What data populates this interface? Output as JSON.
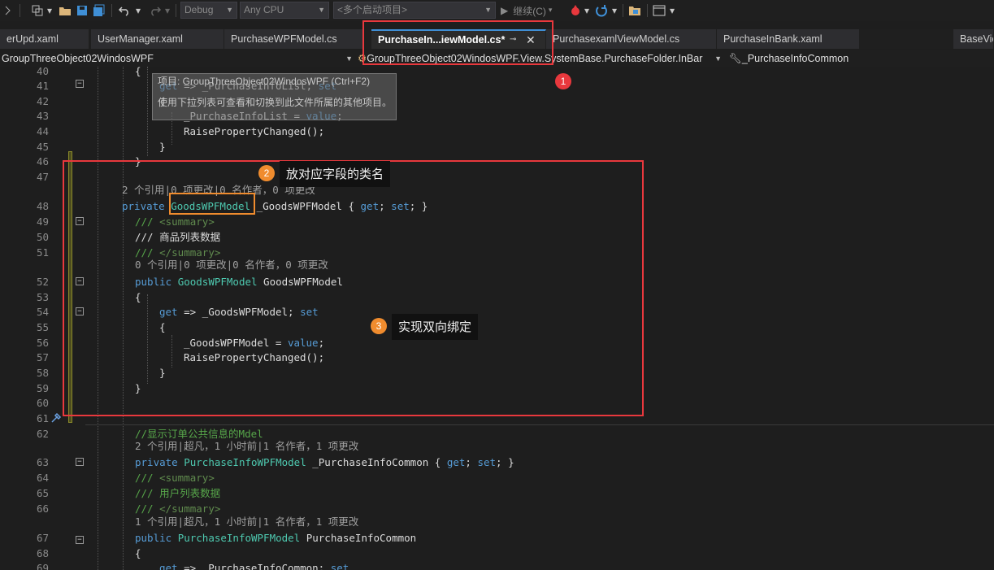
{
  "toolbar": {
    "config": "Debug",
    "platform": "Any CPU",
    "startup": "<多个启动项目>",
    "continue": "继续(C)",
    "colors": {
      "accent": "#3f8fd6",
      "annotation_red": "#e8383d",
      "annotation_orange": "#f08c2e"
    }
  },
  "tabs": [
    {
      "label": "erUpd.xaml"
    },
    {
      "label": "UserManager.xaml"
    },
    {
      "label": "PurchaseWPFModel.cs"
    },
    {
      "label": "PurchaseIn...iewModel.cs*",
      "active": true
    },
    {
      "label": "PurchasexamlViewModel.cs"
    },
    {
      "label": "PurchaseInBank.xaml"
    },
    {
      "label": "BaseVie"
    }
  ],
  "tab_pin": "⊸",
  "tab_close": "✕",
  "navbar": {
    "project": "GroupThreeObject02WindosWPF",
    "class_path": "GroupThreeObject02WindosWPF.View.SystemBase.PurchaseFolder.InBar",
    "member": "_PurchaseInfoCommon"
  },
  "tooltip": {
    "line1": "项目: GroupThreeObject02WindosWPF (Ctrl+F2)",
    "line2": "使用下拉列表可查看和切换到此文件所属的其他项目。"
  },
  "lens": {
    "l48": "2 个引用|0 项更改|0 名作者，0 项更改",
    "l52": "0 个引用|0 项更改|0 名作者，0 项更改",
    "l63": "2 个引用|超凡，1 小时前|1 名作者，1 项更改",
    "l67": "1 个引用|超凡，1 小时前|1 名作者，1 项更改"
  },
  "lines": [
    {
      "n": "40",
      "c": "{"
    },
    {
      "n": "41",
      "c": "get => _PurchaseInfoList; set"
    },
    {
      "n": "42",
      "c": "{"
    },
    {
      "n": "43",
      "c": "_PurchaseInfoList = value;"
    },
    {
      "n": "44",
      "c": "RaisePropertyChanged();"
    },
    {
      "n": "45",
      "c": "}"
    },
    {
      "n": "46",
      "c": "}"
    },
    {
      "n": "47",
      "c": ""
    },
    {
      "n": "48",
      "c": "private GoodsWPFModel _GoodsWPFModel { get; set; }"
    },
    {
      "n": "49",
      "c": "/// <summary>"
    },
    {
      "n": "50",
      "c": "/// 商品列表数据"
    },
    {
      "n": "51",
      "c": "/// </summary>"
    },
    {
      "n": "52",
      "c": "public GoodsWPFModel GoodsWPFModel"
    },
    {
      "n": "53",
      "c": "{"
    },
    {
      "n": "54",
      "c": "get => _GoodsWPFModel; set"
    },
    {
      "n": "55",
      "c": "{"
    },
    {
      "n": "56",
      "c": "_GoodsWPFModel = value;"
    },
    {
      "n": "57",
      "c": "RaisePropertyChanged();"
    },
    {
      "n": "58",
      "c": "}"
    },
    {
      "n": "59",
      "c": "}"
    },
    {
      "n": "60",
      "c": ""
    },
    {
      "n": "61",
      "c": ""
    },
    {
      "n": "62",
      "c": "//显示订单公共信息的Mdel"
    },
    {
      "n": "63",
      "c": "private PurchaseInfoWPFModel _PurchaseInfoCommon { get; set; }"
    },
    {
      "n": "64",
      "c": "/// <summary>"
    },
    {
      "n": "65",
      "c": "/// 用户列表数据"
    },
    {
      "n": "66",
      "c": "/// </summary>"
    },
    {
      "n": "67",
      "c": "public PurchaseInfoWPFModel PurchaseInfoCommon"
    },
    {
      "n": "68",
      "c": "{"
    },
    {
      "n": "69",
      "c": "get => _PurchaseInfoCommon; set"
    }
  ],
  "annotations": {
    "b1": "1",
    "b2": "2",
    "b3": "3",
    "callout2": "放对应字段的类名",
    "callout3": "实现双向绑定"
  }
}
